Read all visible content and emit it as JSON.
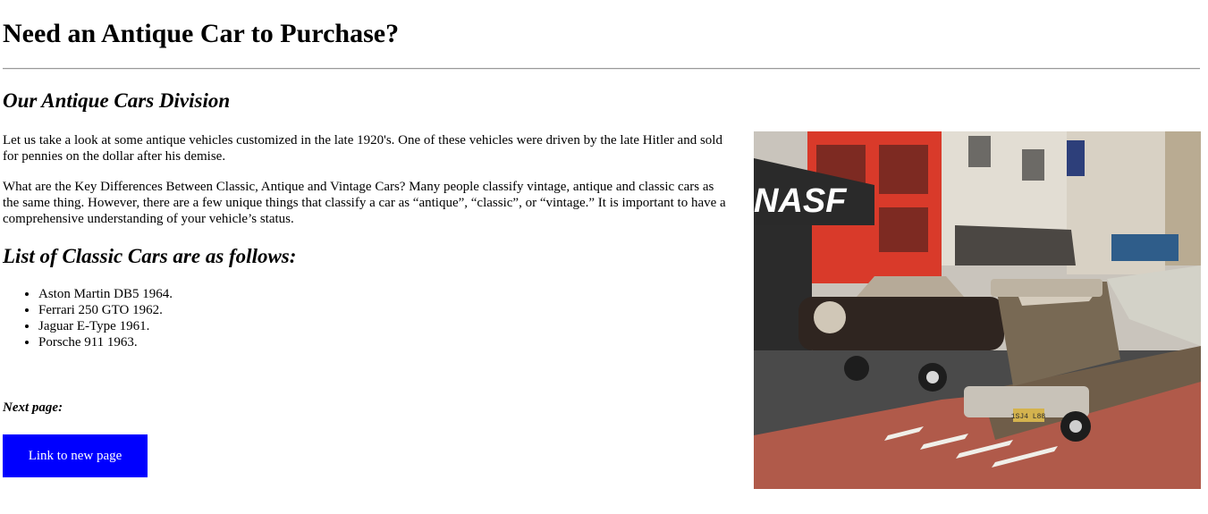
{
  "header": {
    "title": "Need an Antique Car to Purchase?"
  },
  "main": {
    "division_heading": "Our Antique Cars Division",
    "paragraphs": [
      "Let us take a look at some antique vehicles customized in the late 1920's. One of these vehicles were driven by the late Hitler and sold for pennies on the dollar after his demise.",
      "What are the Key Differences Between Classic, Antique and Vintage Cars? Many people classify vintage, antique and classic cars as the same thing. However, there are a few unique things that classify a car as “antique”, “classic”, or “vintage.” It is important to have a comprehensive understanding of your vehicle’s status."
    ],
    "list_heading": "List of Classic Cars are as follows:",
    "cars": [
      "Aston Martin DB5 1964.",
      "Ferrari 250 GTO 1962.",
      "Jaguar E-Type 1961.",
      "Porsche 911 1963."
    ],
    "next_label": "Next page:",
    "cta_label": "Link to new page"
  },
  "photo": {
    "storefront_sign": "NASF",
    "plate_text": "1SJ4 L88"
  },
  "colors": {
    "accent": "#0000ff",
    "storefront_red": "#d93a2a",
    "lane_red": "#b05a4a"
  }
}
